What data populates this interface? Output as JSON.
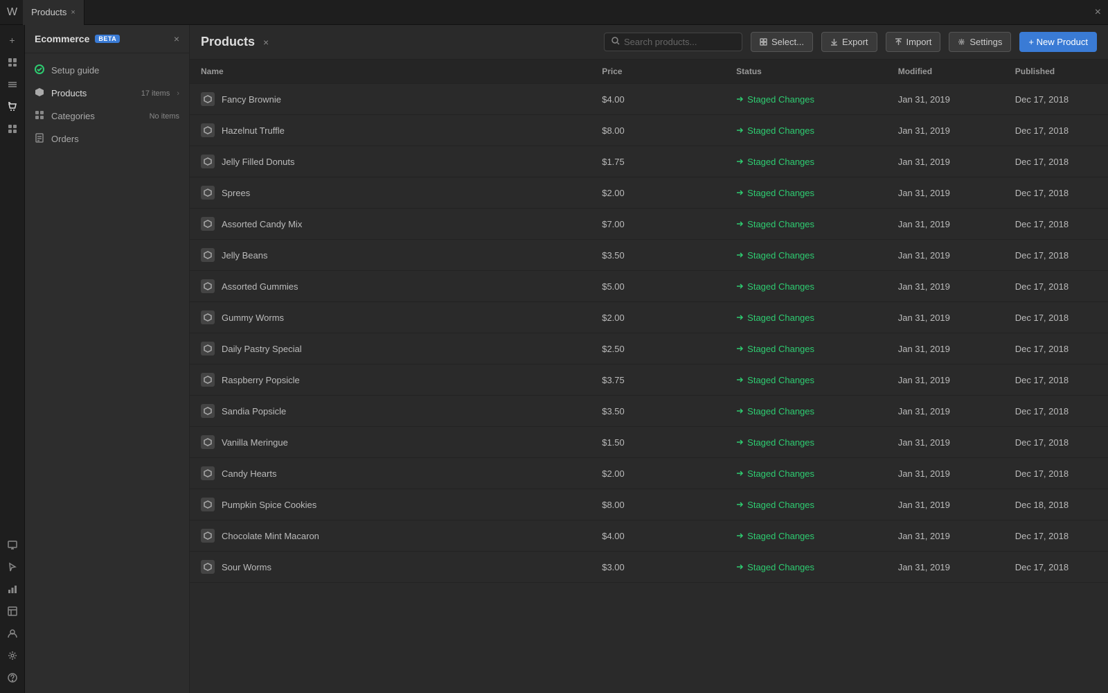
{
  "topbar": {
    "logo": "W",
    "tab_label": "Products",
    "close_icon": "×"
  },
  "sidebar": {
    "title": "Ecommerce",
    "beta_label": "BETA",
    "nav_items": [
      {
        "icon": "✓",
        "label": "Setup guide",
        "count": "",
        "has_arrow": false
      },
      {
        "icon": "◆",
        "label": "Products",
        "count": "17 items",
        "has_arrow": true
      },
      {
        "icon": "⊞",
        "label": "Categories",
        "count": "No items",
        "has_arrow": false
      },
      {
        "icon": "≡",
        "label": "Orders",
        "count": "",
        "has_arrow": false
      }
    ]
  },
  "products": {
    "title": "Products",
    "search_placeholder": "Search products...",
    "buttons": {
      "select": "Select...",
      "export": "Export",
      "import": "Import",
      "settings": "Settings",
      "new_product": "+ New Product"
    },
    "table": {
      "headers": [
        "Name",
        "Price",
        "Status",
        "Modified",
        "Published"
      ],
      "rows": [
        {
          "name": "Fancy Brownie",
          "price": "$4.00",
          "status": "Staged Changes",
          "modified": "Jan 31, 2019",
          "published": "Dec 17, 2018"
        },
        {
          "name": "Hazelnut Truffle",
          "price": "$8.00",
          "status": "Staged Changes",
          "modified": "Jan 31, 2019",
          "published": "Dec 17, 2018"
        },
        {
          "name": "Jelly Filled Donuts",
          "price": "$1.75",
          "status": "Staged Changes",
          "modified": "Jan 31, 2019",
          "published": "Dec 17, 2018"
        },
        {
          "name": "Sprees",
          "price": "$2.00",
          "status": "Staged Changes",
          "modified": "Jan 31, 2019",
          "published": "Dec 17, 2018"
        },
        {
          "name": "Assorted Candy Mix",
          "price": "$7.00",
          "status": "Staged Changes",
          "modified": "Jan 31, 2019",
          "published": "Dec 17, 2018"
        },
        {
          "name": "Jelly Beans",
          "price": "$3.50",
          "status": "Staged Changes",
          "modified": "Jan 31, 2019",
          "published": "Dec 17, 2018"
        },
        {
          "name": "Assorted Gummies",
          "price": "$5.00",
          "status": "Staged Changes",
          "modified": "Jan 31, 2019",
          "published": "Dec 17, 2018"
        },
        {
          "name": "Gummy Worms",
          "price": "$2.00",
          "status": "Staged Changes",
          "modified": "Jan 31, 2019",
          "published": "Dec 17, 2018"
        },
        {
          "name": "Daily Pastry Special",
          "price": "$2.50",
          "status": "Staged Changes",
          "modified": "Jan 31, 2019",
          "published": "Dec 17, 2018"
        },
        {
          "name": "Raspberry Popsicle",
          "price": "$3.75",
          "status": "Staged Changes",
          "modified": "Jan 31, 2019",
          "published": "Dec 17, 2018"
        },
        {
          "name": "Sandia Popsicle",
          "price": "$3.50",
          "status": "Staged Changes",
          "modified": "Jan 31, 2019",
          "published": "Dec 17, 2018"
        },
        {
          "name": "Vanilla Meringue",
          "price": "$1.50",
          "status": "Staged Changes",
          "modified": "Jan 31, 2019",
          "published": "Dec 17, 2018"
        },
        {
          "name": "Candy Hearts",
          "price": "$2.00",
          "status": "Staged Changes",
          "modified": "Jan 31, 2019",
          "published": "Dec 17, 2018"
        },
        {
          "name": "Pumpkin Spice Cookies",
          "price": "$8.00",
          "status": "Staged Changes",
          "modified": "Jan 31, 2019",
          "published": "Dec 18, 2018"
        },
        {
          "name": "Chocolate Mint Macaron",
          "price": "$4.00",
          "status": "Staged Changes",
          "modified": "Jan 31, 2019",
          "published": "Dec 17, 2018"
        },
        {
          "name": "Sour Worms",
          "price": "$3.00",
          "status": "Staged Changes",
          "modified": "Jan 31, 2019",
          "published": "Dec 17, 2018"
        }
      ]
    }
  },
  "iconbar": {
    "icons": [
      {
        "name": "add-icon",
        "glyph": "+"
      },
      {
        "name": "pages-icon",
        "glyph": "⬜"
      },
      {
        "name": "layers-icon",
        "glyph": "≡"
      },
      {
        "name": "shop-icon",
        "glyph": "🛒"
      },
      {
        "name": "components-icon",
        "glyph": "⊞"
      },
      {
        "name": "settings-icon",
        "glyph": "⚙"
      }
    ],
    "bottom_icons": [
      {
        "name": "preview-icon",
        "glyph": "⬚"
      },
      {
        "name": "select-icon",
        "glyph": "⊹"
      },
      {
        "name": "analytics-icon",
        "glyph": "▤"
      },
      {
        "name": "cms-icon",
        "glyph": "⊡"
      },
      {
        "name": "users-icon",
        "glyph": "⚇"
      },
      {
        "name": "help-icon",
        "glyph": "?"
      }
    ]
  }
}
